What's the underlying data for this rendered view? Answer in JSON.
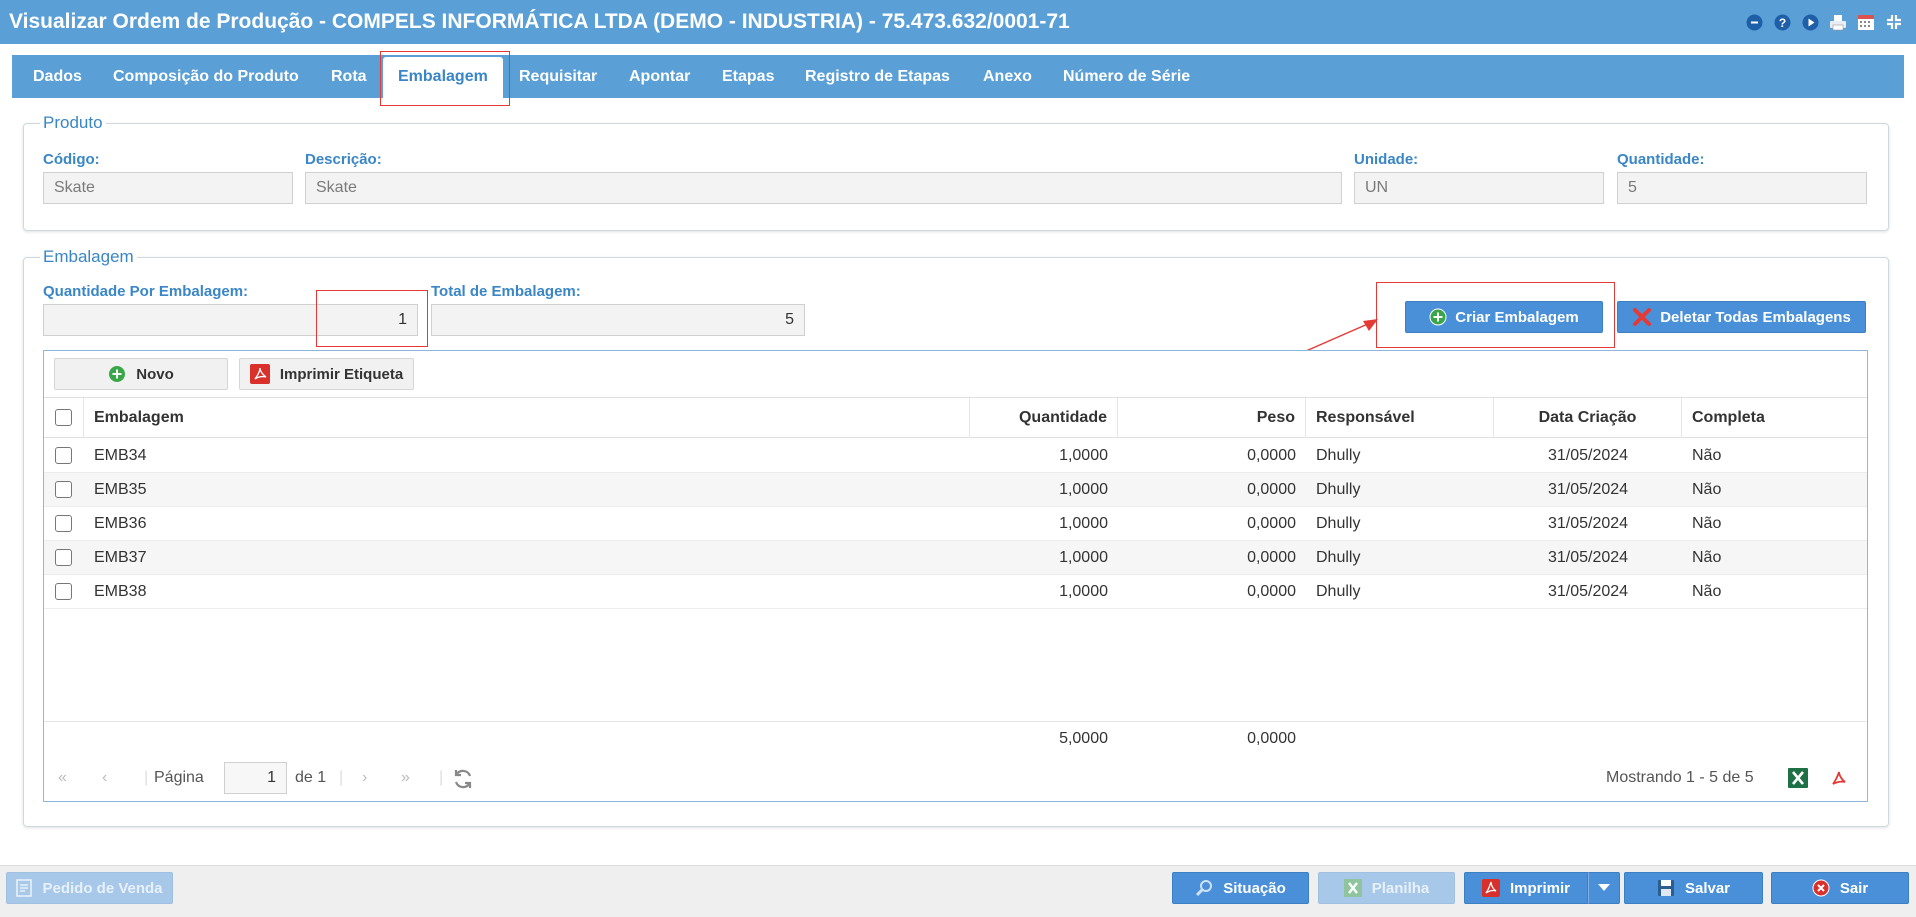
{
  "window": {
    "title": "Visualizar Ordem de Produção - COMPELS INFORMÁTICA LTDA (DEMO - INDUSTRIA) - 75.473.632/0001-71",
    "icons": [
      "minimize-circle-icon",
      "help-icon",
      "play-icon",
      "printer-icon",
      "calendar-icon",
      "collapse-icon"
    ]
  },
  "tabs": [
    {
      "label": "Dados"
    },
    {
      "label": "Composição do Produto"
    },
    {
      "label": "Rota"
    },
    {
      "label": "Embalagem",
      "active": true
    },
    {
      "label": "Requisitar"
    },
    {
      "label": "Apontar"
    },
    {
      "label": "Etapas"
    },
    {
      "label": "Registro de Etapas"
    },
    {
      "label": "Anexo"
    },
    {
      "label": "Número de Série"
    }
  ],
  "produto": {
    "legend": "Produto",
    "codigo_label": "Código:",
    "codigo_value": "Skate",
    "descricao_label": "Descrição:",
    "descricao_value": "Skate",
    "unidade_label": "Unidade:",
    "unidade_value": "UN",
    "quantidade_label": "Quantidade:",
    "quantidade_value": "5"
  },
  "embalagem": {
    "legend": "Embalagem",
    "qtd_por_label": "Quantidade Por Embalagem:",
    "qtd_por_value": "1",
    "total_label": "Total de Embalagem:",
    "total_value": "5",
    "criar_label": "Criar Embalagem",
    "deletar_label": "Deletar Todas Embalagens"
  },
  "grid": {
    "novo_label": "Novo",
    "imprimir_etiqueta_label": "Imprimir Etiqueta",
    "columns": [
      "Embalagem",
      "Quantidade",
      "Peso",
      "Responsável",
      "Data Criação",
      "Completa"
    ],
    "rows": [
      {
        "embalagem": "EMB34",
        "quantidade": "1,0000",
        "peso": "0,0000",
        "responsavel": "Dhully",
        "data": "31/05/2024",
        "completa": "Não"
      },
      {
        "embalagem": "EMB35",
        "quantidade": "1,0000",
        "peso": "0,0000",
        "responsavel": "Dhully",
        "data": "31/05/2024",
        "completa": "Não"
      },
      {
        "embalagem": "EMB36",
        "quantidade": "1,0000",
        "peso": "0,0000",
        "responsavel": "Dhully",
        "data": "31/05/2024",
        "completa": "Não"
      },
      {
        "embalagem": "EMB37",
        "quantidade": "1,0000",
        "peso": "0,0000",
        "responsavel": "Dhully",
        "data": "31/05/2024",
        "completa": "Não"
      },
      {
        "embalagem": "EMB38",
        "quantidade": "1,0000",
        "peso": "0,0000",
        "responsavel": "Dhully",
        "data": "31/05/2024",
        "completa": "Não"
      }
    ],
    "sum_quantidade": "5,0000",
    "sum_peso": "0,0000",
    "pager": {
      "pagina_label": "Página",
      "page_value": "1",
      "de_label": "de 1",
      "mostrando": "Mostrando 1 - 5 de 5"
    }
  },
  "bottom": {
    "pedido_label": "Pedido de Venda",
    "situacao_label": "Situação",
    "planilha_label": "Planilha",
    "imprimir_label": "Imprimir",
    "salvar_label": "Salvar",
    "sair_label": "Sair"
  },
  "colors": {
    "accent": "#5a9fd6",
    "button": "#4a90d9",
    "highlight": "#e53935"
  }
}
